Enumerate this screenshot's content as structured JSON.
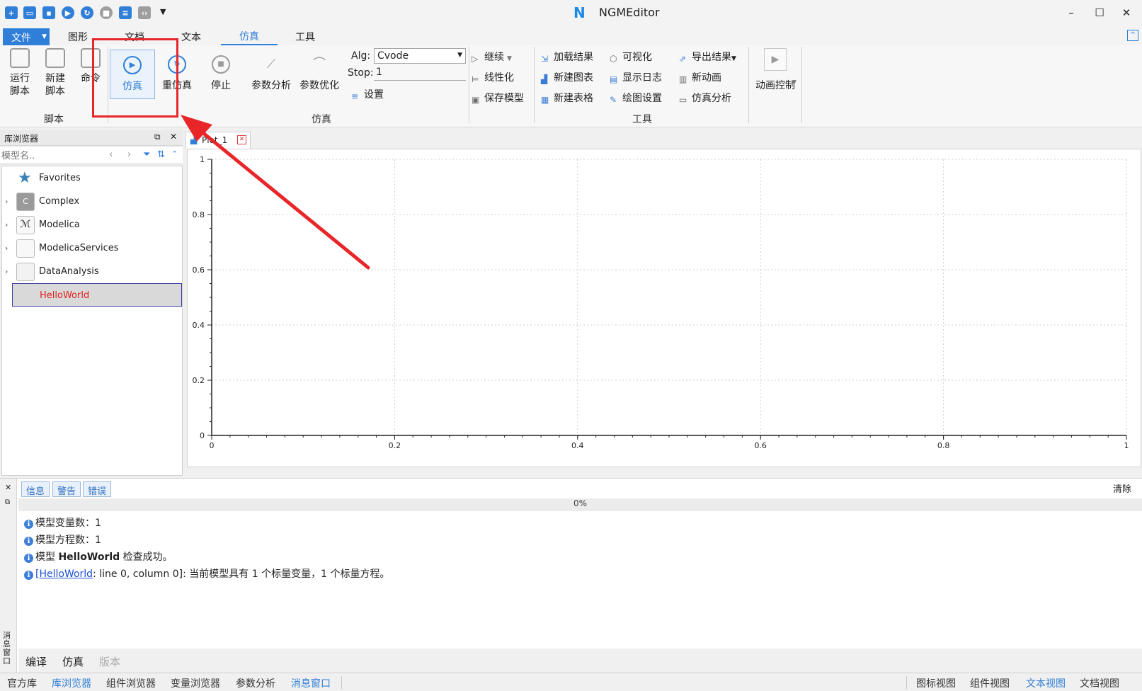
{
  "app": {
    "title": "NGMEditor"
  },
  "window_controls": {
    "minimize": "–",
    "maximize": "☐",
    "close": "✕"
  },
  "menu_tabs": [
    {
      "label": "文件"
    },
    {
      "label": "图形"
    },
    {
      "label": "文档"
    },
    {
      "label": "文本"
    },
    {
      "label": "仿真"
    },
    {
      "label": "工具"
    }
  ],
  "ribbon": {
    "script_group": {
      "label": "脚本",
      "run_script": "运行\n脚本",
      "new_script": "新建\n脚本",
      "command": "命令"
    },
    "sim_group": {
      "label": "仿真",
      "simulate": "仿真",
      "resimulate": "重仿真",
      "stop": "停止",
      "param_analysis": "参数分析",
      "param_optimize": "参数优化",
      "alg_label": "Alg:",
      "alg_value": "Cvode",
      "stop_label": "Stop:",
      "stop_value": "1",
      "settings": "设置",
      "continue": "继续",
      "linearize": "线性化",
      "save_model": "保存模型"
    },
    "tools_group": {
      "label": "工具",
      "load_result": "加载结果",
      "new_chart": "新建图表",
      "new_table": "新建表格",
      "visualize": "可视化",
      "show_log": "显示日志",
      "plot_settings": "绘图设置",
      "export_result": "导出结果",
      "new_animation": "新动画",
      "sim_analysis": "仿真分析"
    },
    "anim_group": {
      "anim_control": "动画控制"
    }
  },
  "library_browser": {
    "title": "库浏览器",
    "search_placeholder": "模型名..",
    "items": [
      {
        "label": "Favorites"
      },
      {
        "label": "Complex",
        "icon_text": "C"
      },
      {
        "label": "Modelica"
      },
      {
        "label": "ModelicaServices"
      },
      {
        "label": "DataAnalysis"
      },
      {
        "label": "HelloWorld"
      }
    ]
  },
  "plot": {
    "tab_label": "Plot_1",
    "chart_data": {
      "type": "line",
      "title": "",
      "xlabel": "",
      "ylabel": "",
      "xlim": [
        0,
        1
      ],
      "ylim": [
        0,
        1
      ],
      "x_ticks": [
        "0",
        "0.2",
        "0.4",
        "0.6",
        "0.8",
        "1"
      ],
      "y_ticks": [
        "0",
        "0.2",
        "0.4",
        "0.6",
        "0.8",
        "1"
      ],
      "grid": true,
      "series": []
    }
  },
  "messages": {
    "filters": [
      "信息",
      "警告",
      "错误"
    ],
    "clear": "清除",
    "progress": "0%",
    "lines": {
      "l1": "模型变量数：1",
      "l2": "模型方程数：1",
      "l3_pre": "模型 ",
      "l3_bold": "HelloWorld",
      "l3_post": " 检查成功。",
      "l4_link": "[HelloWorld",
      "l4_post": ": line 0, column 0]: 当前模型具有 1 个标量变量，1 个标量方程。"
    },
    "side_label": "消息窗口",
    "bottom_tabs": [
      "编译",
      "仿真",
      "版本"
    ]
  },
  "status_bar": {
    "left": [
      "官方库",
      "库浏览器",
      "组件浏览器",
      "变量浏览器",
      "参数分析",
      "消息窗口"
    ],
    "right": [
      "图标视图",
      "组件视图",
      "文本视图",
      "文档视图"
    ]
  },
  "colors": {
    "accent": "#2f7ed8",
    "annotation": "#e8262a"
  }
}
